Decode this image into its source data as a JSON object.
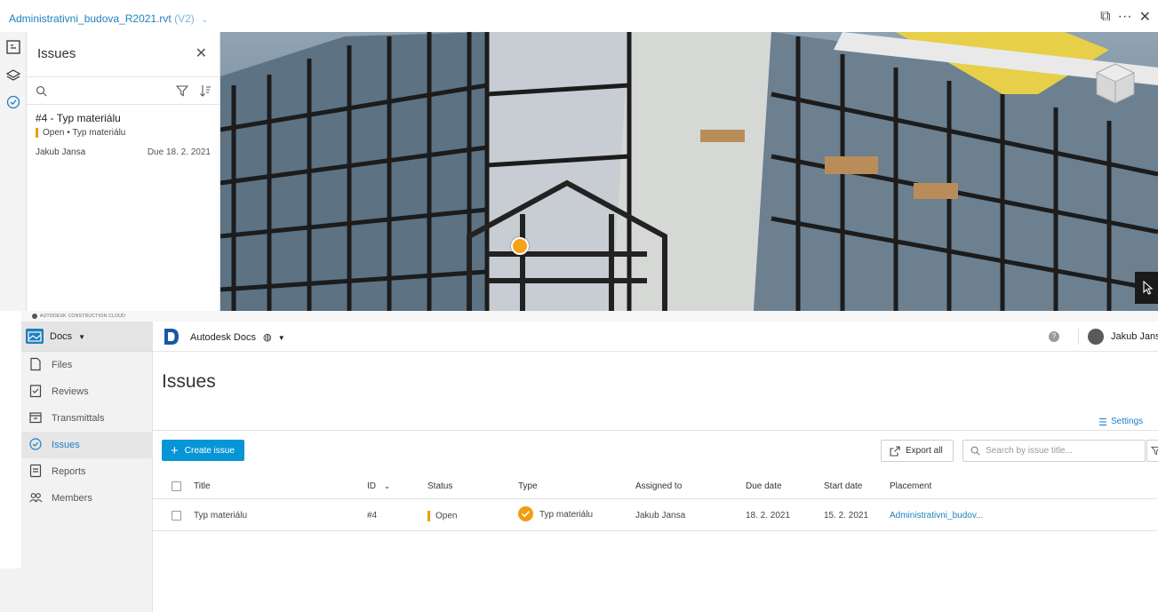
{
  "window": {
    "file_name": "Administrativni_budova_R2021.rvt",
    "version": "(V2)"
  },
  "issues_panel": {
    "title": "Issues",
    "issue": {
      "title": "#4 - Typ materiálu",
      "status_line": "Open • Typ materiálu",
      "assignee": "Jakub Jansa",
      "due": "Due 18. 2. 2021"
    }
  },
  "brand_strip": {
    "text": "AUTODESK CONSTRUCTION CLOUD"
  },
  "docs_nav": {
    "switcher_label": "Docs",
    "items": [
      {
        "label": "Files",
        "icon": "file-icon"
      },
      {
        "label": "Reviews",
        "icon": "reviews-icon"
      },
      {
        "label": "Transmittals",
        "icon": "transmittals-icon"
      },
      {
        "label": "Issues",
        "icon": "issues-icon",
        "active": true
      },
      {
        "label": "Reports",
        "icon": "reports-icon"
      },
      {
        "label": "Members",
        "icon": "members-icon"
      }
    ]
  },
  "header": {
    "product_name": "Autodesk Docs",
    "user_name": "Jakub Jansa"
  },
  "page": {
    "title": "Issues",
    "settings_label": "Settings",
    "create_label": "Create issue",
    "export_label": "Export all",
    "search_placeholder": "Search by issue title..."
  },
  "table": {
    "columns": [
      "Title",
      "ID",
      "Status",
      "Type",
      "Assigned to",
      "Due date",
      "Start date",
      "Placement"
    ],
    "rows": [
      {
        "title": "Typ materiálu",
        "id": "#4",
        "status": "Open",
        "type": "Typ materiálu",
        "assigned_to": "Jakub Jansa",
        "due_date": "18. 2. 2021",
        "start_date": "15. 2. 2021",
        "placement": "Administrativni_budov..."
      }
    ]
  },
  "colors": {
    "accent": "#0696d7",
    "link": "#1f7fbf",
    "open_status": "#f39c12"
  }
}
